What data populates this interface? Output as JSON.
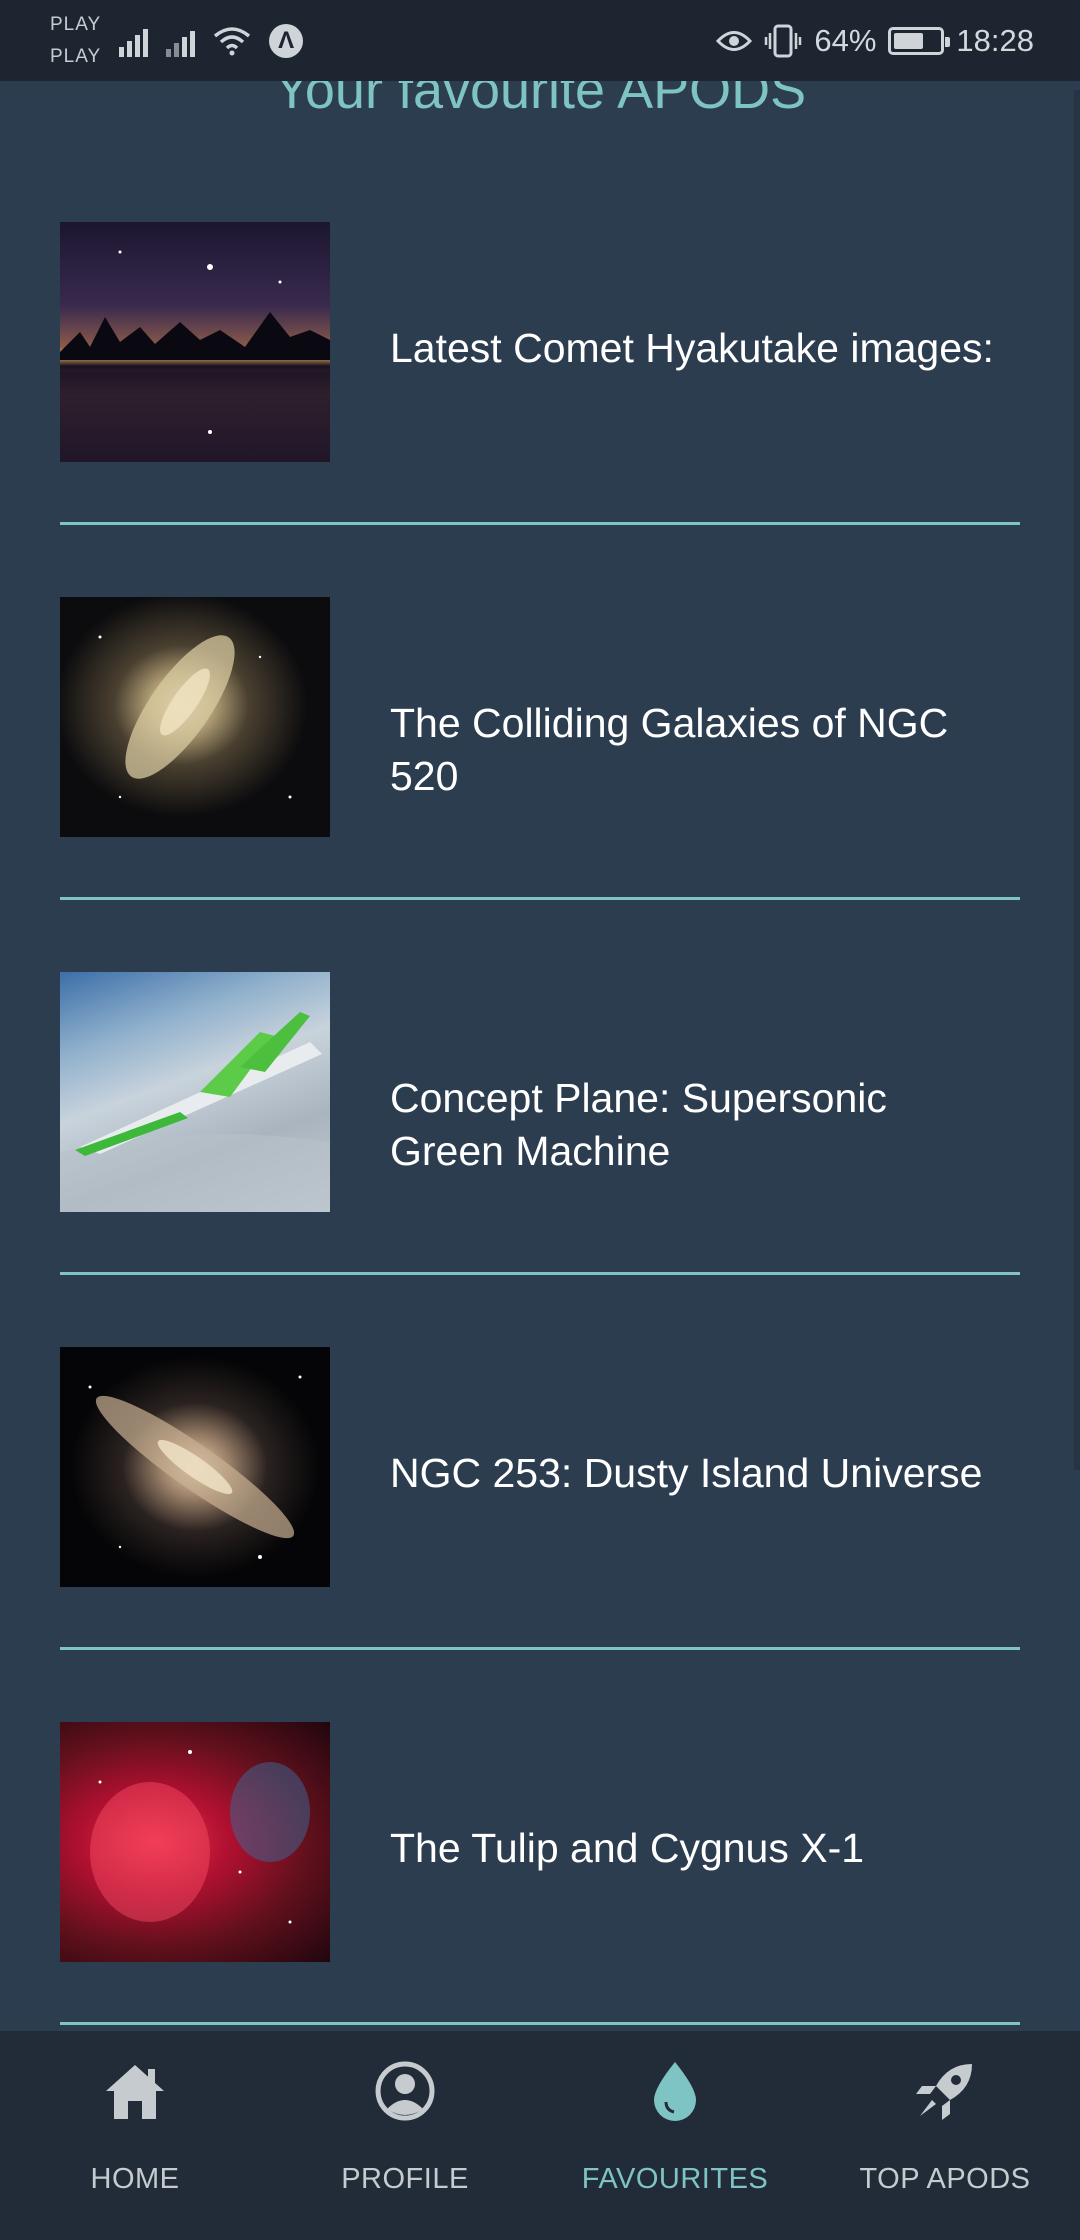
{
  "status_bar": {
    "carrier_1": "PLAY",
    "carrier_2": "PLAY",
    "battery_percent": "64%",
    "battery_level": 0.64,
    "time": "18:28",
    "icons": [
      "signal-icon",
      "signal-icon",
      "wifi-icon",
      "a-badge-icon",
      "eye-icon",
      "vibrate-icon",
      "battery-icon"
    ]
  },
  "page": {
    "title": "Your favourite APODS"
  },
  "favourites": [
    {
      "title": " Latest Comet Hyakutake images:",
      "thumbnail": "comet-night-sky"
    },
    {
      "title": " The Colliding Galaxies of NGC 520",
      "thumbnail": "colliding-galaxies"
    },
    {
      "title": " Concept Plane: Supersonic Green Machine",
      "thumbnail": "supersonic-plane"
    },
    {
      "title": " NGC 253: Dusty Island Universe",
      "thumbnail": "spiral-galaxy"
    },
    {
      "title": " The Tulip and Cygnus X-1",
      "thumbnail": "red-nebula"
    }
  ],
  "bottom_nav": {
    "items": [
      {
        "label": "HOME",
        "icon": "home-icon",
        "active": false
      },
      {
        "label": "PROFILE",
        "icon": "profile-icon",
        "active": false
      },
      {
        "label": "FAVOURITES",
        "icon": "drop-icon",
        "active": true
      },
      {
        "label": "TOP APODS",
        "icon": "rocket-icon",
        "active": false
      }
    ]
  },
  "colors": {
    "background": "#2d3d50",
    "accent": "#7fc4c4",
    "nav_background": "#222c38",
    "status_background": "#1c2530"
  }
}
